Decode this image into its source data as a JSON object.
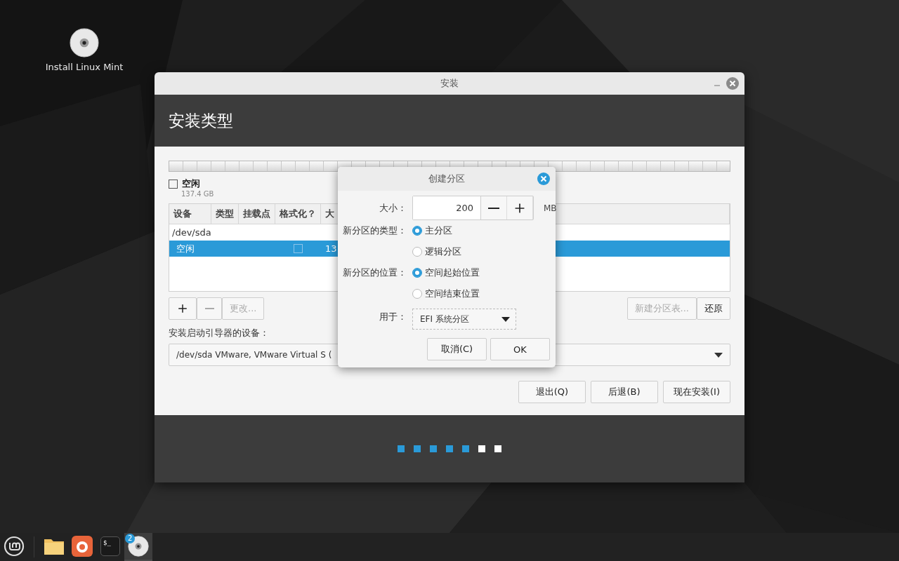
{
  "desktop": {
    "icons": [
      {
        "label": "Install Linux Mint"
      }
    ]
  },
  "window": {
    "title": "安装",
    "heading": "安装类型",
    "legend": [
      {
        "label": "空闲",
        "size": "137.4 GB",
        "checked": false
      }
    ],
    "table": {
      "columns": [
        "设备",
        "类型",
        "挂载点",
        "格式化？",
        "大"
      ],
      "rows": [
        {
          "device": "/dev/sda",
          "selected": false
        },
        {
          "device": "空闲",
          "format_checked": false,
          "size": "13",
          "selected": true
        }
      ]
    },
    "table_buttons": [
      {
        "kind": "add",
        "disabled": false
      },
      {
        "kind": "remove",
        "disabled": true
      },
      {
        "kind": "text",
        "label": "更改...",
        "disabled": true
      }
    ],
    "table_buttons_right": [
      {
        "label": "新建分区表...",
        "disabled": true
      },
      {
        "label": "还原",
        "disabled": false
      }
    ],
    "bootloader": {
      "label": "安装启动引导器的设备：",
      "value": "/dev/sda VMware, VMware Virtual S ("
    },
    "actions": [
      {
        "label": "退出(Q)"
      },
      {
        "label": "后退(B)"
      },
      {
        "label": "现在安装(I)"
      }
    ],
    "progress": [
      {
        "done": true
      },
      {
        "done": true
      },
      {
        "done": true
      },
      {
        "done": true
      },
      {
        "done": true
      },
      {
        "done": false
      },
      {
        "done": false
      }
    ]
  },
  "dialog": {
    "title": "创建分区",
    "size": {
      "label": "大小：",
      "value": "200",
      "unit": "MB"
    },
    "groups": [
      {
        "label": "新分区的类型：",
        "options": [
          {
            "label": "主分区",
            "selected": true
          },
          {
            "label": "逻辑分区",
            "selected": false
          }
        ]
      },
      {
        "label": "新分区的位置：",
        "options": [
          {
            "label": "空间起始位置",
            "selected": true
          },
          {
            "label": "空间结束位置",
            "selected": false
          }
        ]
      }
    ],
    "use": {
      "label": "用于：",
      "value": "EFI 系统分区"
    },
    "buttons": [
      {
        "label": "取消(C)"
      },
      {
        "label": "OK"
      }
    ]
  },
  "taskbar": {
    "items": [
      {
        "kind": "menu",
        "active": false
      },
      {
        "kind": "folder",
        "active": false
      },
      {
        "kind": "browser",
        "active": false
      },
      {
        "kind": "terminal",
        "glyph": "$_",
        "active": false
      },
      {
        "kind": "disc",
        "badge": "2",
        "active": true
      }
    ]
  }
}
